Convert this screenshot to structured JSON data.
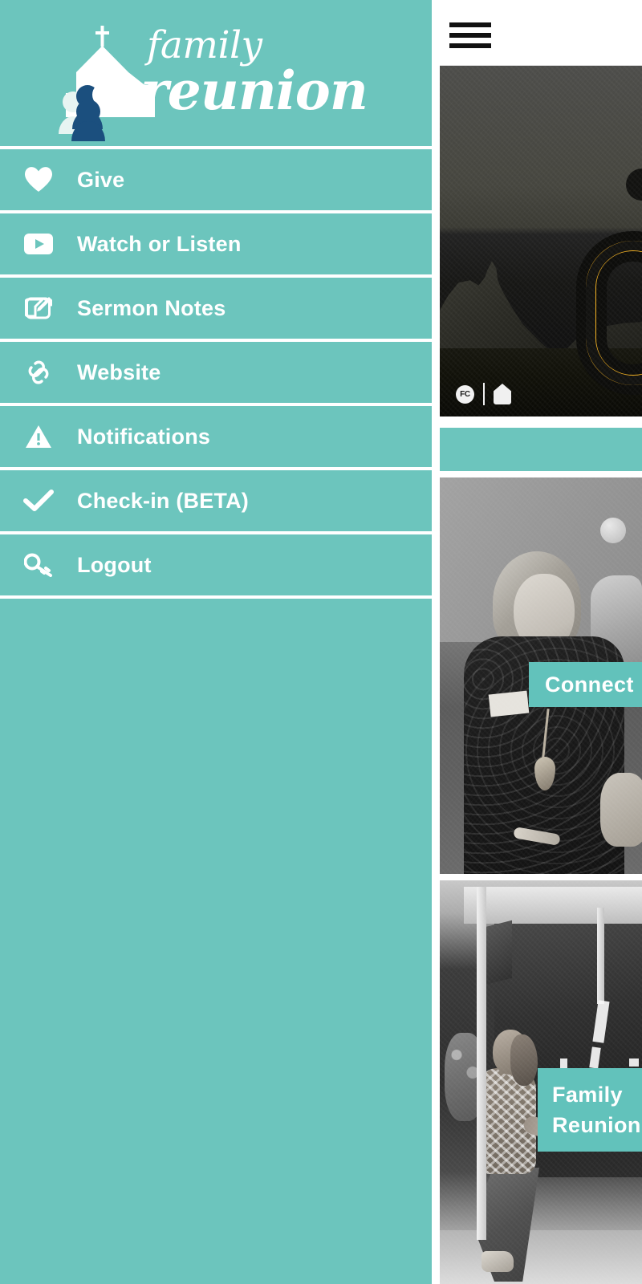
{
  "app": {
    "brand_line1": "family",
    "brand_line2": "reunion",
    "accent_color": "#6cc5bd",
    "banner_color": "#62c2bb",
    "logo_navy": "#1b4f7e"
  },
  "header": {
    "menu_toggle_label": "Menu",
    "menu_icon": "hamburger-icon"
  },
  "sidebar": {
    "logo_icon": "church-family-logo-icon",
    "items": [
      {
        "label": "Give",
        "icon": "heart-icon"
      },
      {
        "label": "Watch or Listen",
        "icon": "play-video-icon"
      },
      {
        "label": "Sermon Notes",
        "icon": "note-edit-icon"
      },
      {
        "label": "Website",
        "icon": "link-chain-icon"
      },
      {
        "label": "Notifications",
        "icon": "warning-triangle-icon"
      },
      {
        "label": "Check-in (BETA)",
        "icon": "checkmark-icon"
      },
      {
        "label": "Logout",
        "icon": "key-icon"
      }
    ]
  },
  "main": {
    "cards": [
      {
        "id": "desert-card",
        "image_alt": "desert-landscape-photo",
        "overlay": {
          "badge_text": "FC",
          "badge_icon": "fc-circle-icon",
          "house_icon": "house-icon"
        },
        "banner": ""
      },
      {
        "id": "connect-card",
        "image_alt": "woman-smiling-photo",
        "banner": "Connect"
      },
      {
        "id": "reunion-card",
        "image_alt": "young-woman-outside-building-photo",
        "banner_line1": "Family",
        "banner_line2": "Reunion"
      }
    ]
  }
}
